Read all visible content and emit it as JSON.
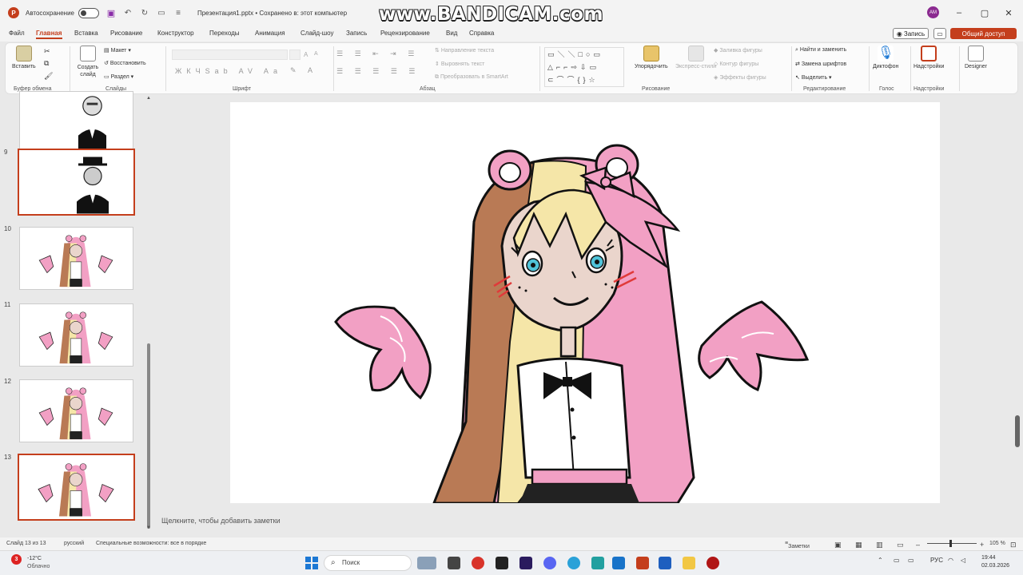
{
  "titlebar": {
    "autosave_label": "Автосохранение",
    "document_title": "Презентация1.pptx  •  Сохранено в: этот компьютер",
    "watermark": "www.BANDICAM.com",
    "user_initials": "AM"
  },
  "menu": {
    "tabs": [
      "Файл",
      "Главная",
      "Вставка",
      "Рисование",
      "Конструктор",
      "Переходы",
      "Анимация",
      "Слайд-шоу",
      "Запись",
      "Рецензирование",
      "Вид",
      "Справка"
    ],
    "active_tab": "Главная",
    "record_button": "Запись",
    "share_button": "Общий доступ"
  },
  "ribbon": {
    "clipboard": {
      "paste": "Вставить",
      "group": "Буфер обмена"
    },
    "slides": {
      "new_slide": "Создать слайд",
      "layout": "Макет",
      "reset": "Восстановить",
      "section": "Раздел",
      "group": "Слайды"
    },
    "font": {
      "group": "Шрифт",
      "bold": "Ж",
      "italic": "К",
      "underline": "Ч",
      "strike": "S"
    },
    "paragraph": {
      "group": "Абзац",
      "text_direction": "Направление текста",
      "align_text": "Выровнять текст",
      "smartart": "Преобразовать в SmartArt"
    },
    "drawing": {
      "arrange": "Упорядочить",
      "quick_styles": "Экспресс-стили",
      "shape_fill": "Заливка фигуры",
      "shape_outline": "Контур фигуры",
      "shape_effects": "Эффекты фигуры",
      "group": "Рисование"
    },
    "editing": {
      "find": "Найти и заменить",
      "replace_fonts": "Замена шрифтов",
      "select": "Выделить",
      "group": "Редактирование"
    },
    "voice": {
      "dictate": "Диктофон",
      "group": "Голос"
    },
    "addins": {
      "addins": "Надстройки",
      "group": "Надстройки"
    },
    "designer": {
      "label": "Designer"
    }
  },
  "thumbnails": [
    {
      "number": "",
      "kind": "man"
    },
    {
      "number": "9",
      "kind": "man-hat"
    },
    {
      "number": "10",
      "kind": "girl"
    },
    {
      "number": "11",
      "kind": "girl"
    },
    {
      "number": "12",
      "kind": "girl"
    },
    {
      "number": "13",
      "kind": "girl"
    }
  ],
  "notes_placeholder": "Щелкните, чтобы добавить заметки",
  "statusbar": {
    "slide_counter": "Слайд 13 из 13",
    "language": "русский",
    "accessibility": "Специальные возможности: все в порядке",
    "notes_button": "Заметки",
    "zoom": "105 %"
  },
  "taskbar": {
    "weather_badge": "3",
    "temperature": "-12°C",
    "weather_desc": "Облачно",
    "search_placeholder": "Поиск",
    "language": "РУС",
    "time": "19:44",
    "date": "02.03.2026"
  },
  "colors": {
    "accent": "#c43e1c",
    "hair_pink": "#f2a0c4",
    "hair_blonde": "#f5e6a8",
    "hair_brown": "#b97a55",
    "skin": "#ead5cc",
    "eye": "#4fc3d9",
    "blush": "#e03a3a"
  }
}
